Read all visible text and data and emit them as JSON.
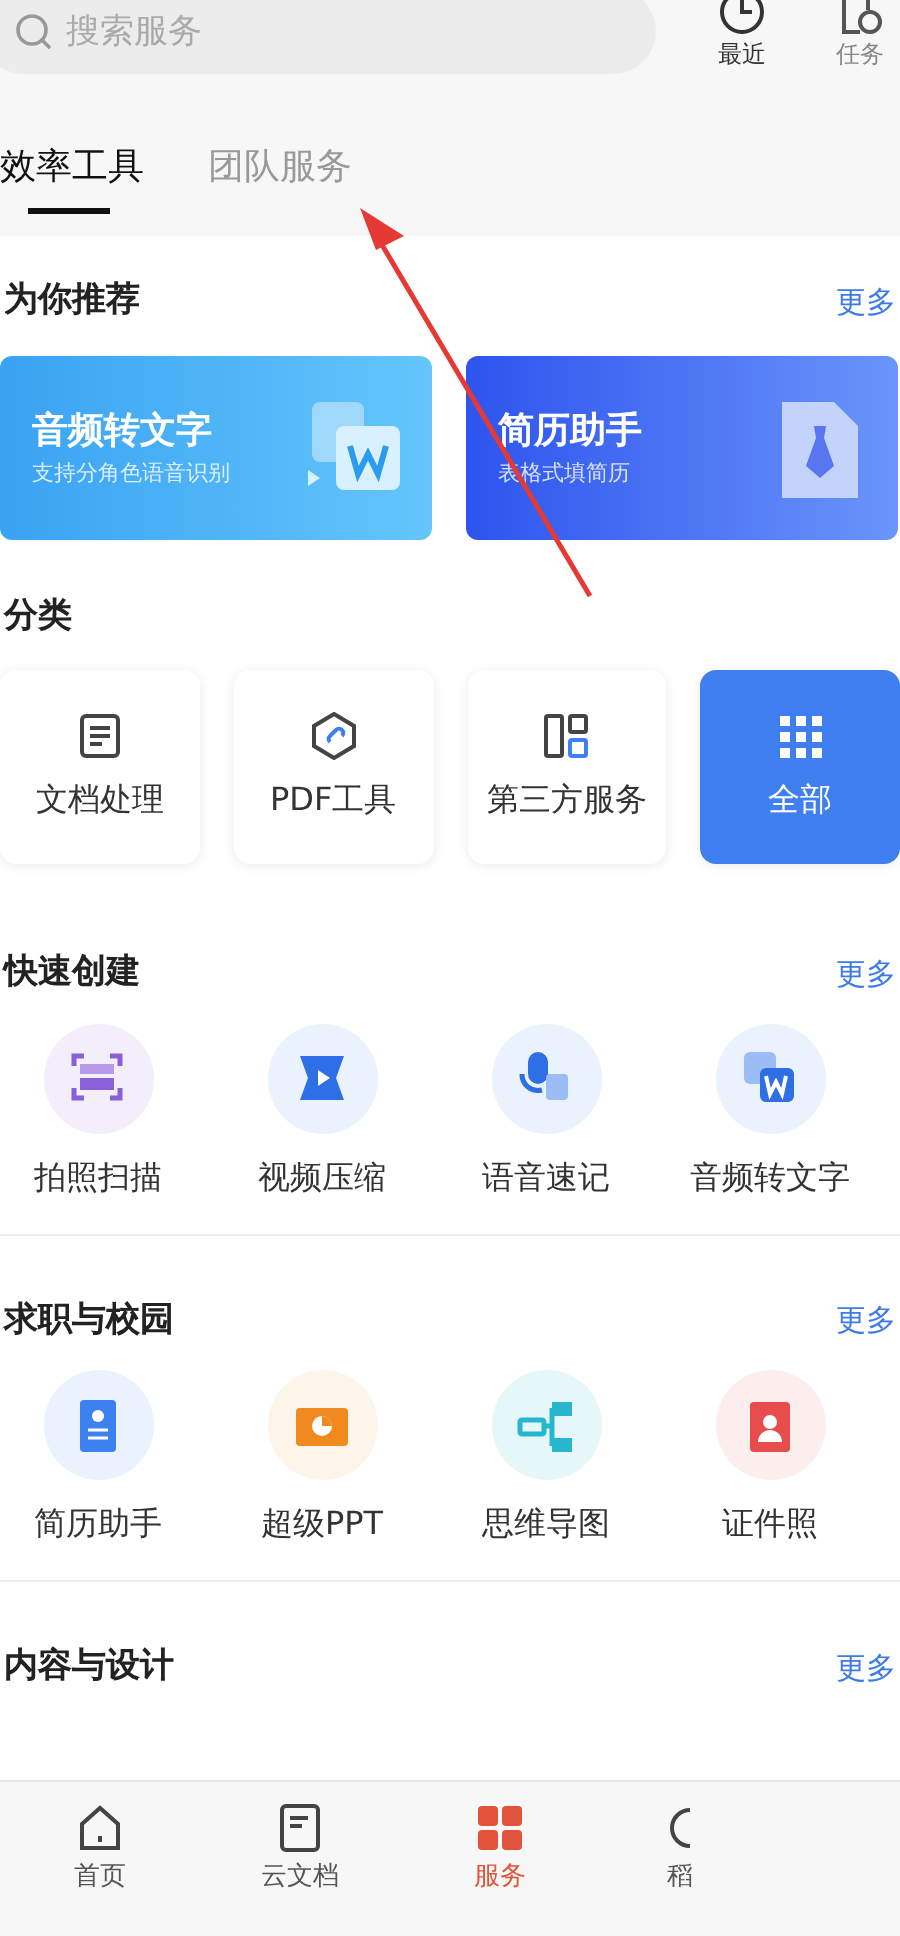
{
  "search": {
    "placeholder": "搜索服务"
  },
  "top_actions": [
    {
      "kind": "clock",
      "label": "最近"
    },
    {
      "kind": "task",
      "label": "任务"
    }
  ],
  "tabs": [
    {
      "label": "效率工具",
      "selected": true
    },
    {
      "label": "团队服务",
      "selected": false
    }
  ],
  "recommend": {
    "title": "为你推荐",
    "more": "更多",
    "cards": [
      {
        "kind": "audio",
        "title": "音频转文字",
        "subtitle": "支持分角色语音识别"
      },
      {
        "kind": "resume",
        "title": "简历助手",
        "subtitle": "表格式填简历"
      }
    ]
  },
  "categories": {
    "title": "分类",
    "items": [
      {
        "kind": "doc",
        "label": "文档处理",
        "selected": false
      },
      {
        "kind": "pdf",
        "label": "PDF工具",
        "selected": false
      },
      {
        "kind": "third",
        "label": "第三方服务",
        "selected": false
      },
      {
        "kind": "all",
        "label": "全部",
        "selected": true
      }
    ]
  },
  "sections": [
    {
      "title": "快速创建",
      "more": "更多",
      "items": [
        {
          "kind": "scan",
          "label": "拍照扫描",
          "color": "#f3eefc"
        },
        {
          "kind": "video",
          "label": "视频压缩",
          "color": "#eaf2fe"
        },
        {
          "kind": "voice",
          "label": "语音速记",
          "color": "#eaf2fe"
        },
        {
          "kind": "audio",
          "label": "音频转文字",
          "color": "#eaf2fe"
        }
      ]
    },
    {
      "title": "求职与校园",
      "more": "更多",
      "items": [
        {
          "kind": "resume",
          "label": "简历助手",
          "color": "#eaf2fe"
        },
        {
          "kind": "ppt",
          "label": "超级PPT",
          "color": "#fef5ea"
        },
        {
          "kind": "mind",
          "label": "思维导图",
          "color": "#e6f7fa"
        },
        {
          "kind": "idphoto",
          "label": "证件照",
          "color": "#fdeeee"
        }
      ]
    },
    {
      "title": "内容与设计",
      "more": "更多"
    }
  ],
  "bottom_nav": [
    {
      "kind": "home",
      "label": "首页",
      "selected": false
    },
    {
      "kind": "docs",
      "label": "云文档",
      "selected": false
    },
    {
      "kind": "service",
      "label": "服务",
      "selected": true
    },
    {
      "kind": "shell",
      "label": "稻",
      "selected": false
    }
  ]
}
